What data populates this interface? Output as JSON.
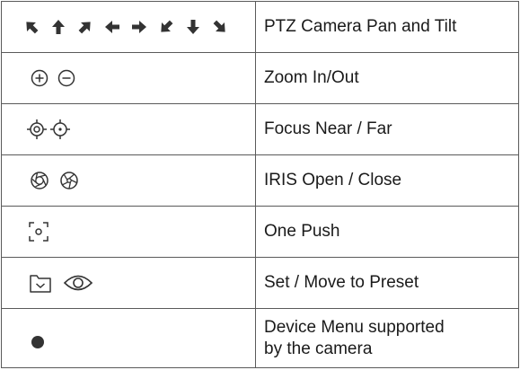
{
  "table": {
    "rows": [
      {
        "icon": "ptz-directional-arrows-icon",
        "label": "PTZ Camera Pan and Tilt"
      },
      {
        "icon": "zoom-in-out-icon",
        "label": "Zoom In/Out"
      },
      {
        "icon": "focus-near-far-icon",
        "label": "Focus Near / Far"
      },
      {
        "icon": "iris-open-close-icon",
        "label": "IRIS Open / Close"
      },
      {
        "icon": "one-push-icon",
        "label": "One Push"
      },
      {
        "icon": "preset-set-move-icon",
        "label": "Set / Move to Preset"
      },
      {
        "icon": "device-menu-dot-icon",
        "label": "Device Menu supported\nby the camera"
      }
    ]
  },
  "colors": {
    "icon": "#333333",
    "border": "#5a5a5a",
    "text": "#1a1a1a"
  }
}
